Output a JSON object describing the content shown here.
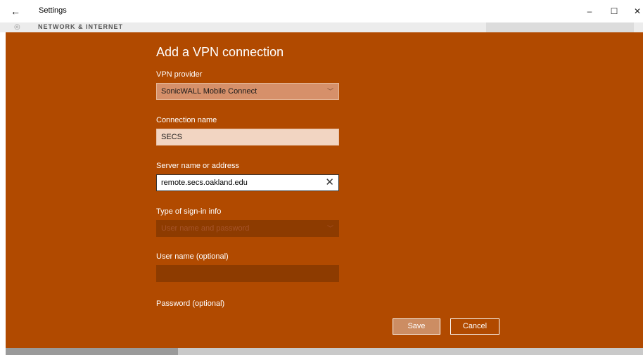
{
  "window": {
    "title": "Settings",
    "back_glyph": "←",
    "minimize_glyph": "–",
    "maximize_glyph": "☐",
    "close_glyph": "✕"
  },
  "background": {
    "section_title": "NETWORK & INTERNET"
  },
  "dialog": {
    "heading": "Add a VPN connection",
    "vpn_provider": {
      "label": "VPN provider",
      "value": "SonicWALL Mobile Connect"
    },
    "connection_name": {
      "label": "Connection name",
      "value": "SECS"
    },
    "server": {
      "label": "Server name or address",
      "value": "remote.secs.oakland.edu"
    },
    "signin_type": {
      "label": "Type of sign-in info",
      "value": "User name and password"
    },
    "username": {
      "label": "User name (optional)",
      "value": ""
    },
    "password": {
      "label": "Password (optional)"
    },
    "save_label": "Save",
    "cancel_label": "Cancel"
  },
  "colors": {
    "accent": "#b14a00",
    "disabled_field": "#8d3b00",
    "save_button": "#cc8d63"
  }
}
